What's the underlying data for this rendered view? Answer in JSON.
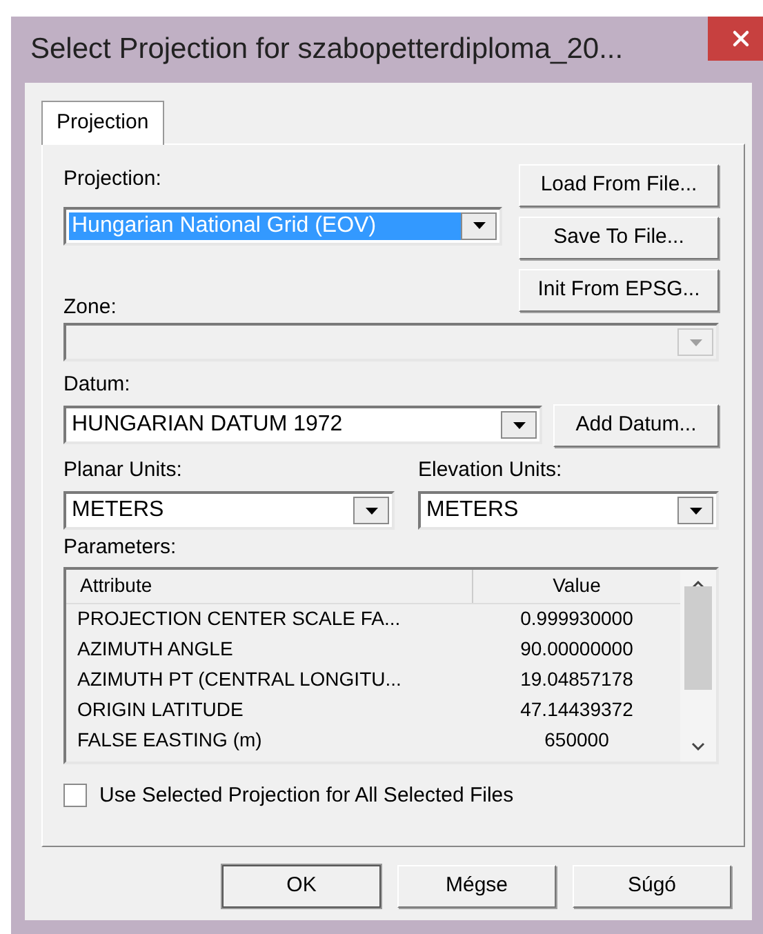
{
  "window": {
    "title": "Select Projection for szabopetterdiploma_20..."
  },
  "tabs": [
    {
      "label": "Projection",
      "selected": true
    }
  ],
  "projection": {
    "label": "Projection:",
    "value": "Hungarian National Grid (EOV)",
    "highlighted": true,
    "disabled": false
  },
  "file_buttons": [
    "Load From File...",
    "Save To File...",
    "Init From EPSG..."
  ],
  "zone": {
    "label": "Zone:",
    "disabled": true
  },
  "datum": {
    "label": "Datum:",
    "value": "HUNGARIAN DATUM 1972",
    "highlighted": false,
    "disabled": false
  },
  "datum_button": "Add Datum...",
  "planar_units": {
    "label": "Planar Units:",
    "value": "METERS",
    "highlighted": false,
    "disabled": false
  },
  "elevation_units": {
    "label": "Elevation Units:",
    "value": "METERS",
    "highlighted": false,
    "disabled": false
  },
  "parameters": {
    "label": "Parameters:",
    "columns": [
      "Attribute",
      "Value"
    ],
    "rows": [
      {
        "attribute": "PROJECTION CENTER SCALE FA...",
        "value": "0.999930000"
      },
      {
        "attribute": "AZIMUTH ANGLE",
        "value": "90.00000000"
      },
      {
        "attribute": "AZIMUTH PT (CENTRAL LONGITU...",
        "value": "19.04857178"
      },
      {
        "attribute": "ORIGIN LATITUDE",
        "value": "47.14439372"
      },
      {
        "attribute": "FALSE EASTING (m)",
        "value": "650000"
      }
    ]
  },
  "use_for_all": {
    "label": "Use Selected Projection for All Selected Files",
    "checked": false
  },
  "buttons": [
    {
      "label": "OK",
      "default": true
    },
    {
      "label": "Mégse",
      "default": false
    },
    {
      "label": "Súgó",
      "default": false
    }
  ]
}
